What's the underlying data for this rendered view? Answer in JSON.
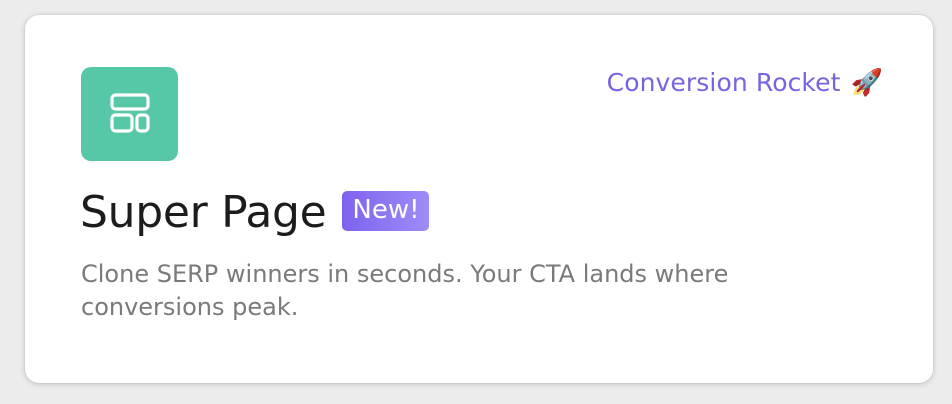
{
  "card": {
    "icon": "layout-blocks-icon",
    "brand_label": "Conversion Rocket",
    "brand_emoji": "🚀",
    "title": "Super Page",
    "badge": "New!",
    "description": "Clone SERP winners in seconds. Your CTA lands where conversions peak."
  },
  "colors": {
    "icon_tile": "#56c8a8",
    "brand": "#7a62e0",
    "badge_start": "#7e62ee",
    "badge_end": "#a08cf8"
  }
}
